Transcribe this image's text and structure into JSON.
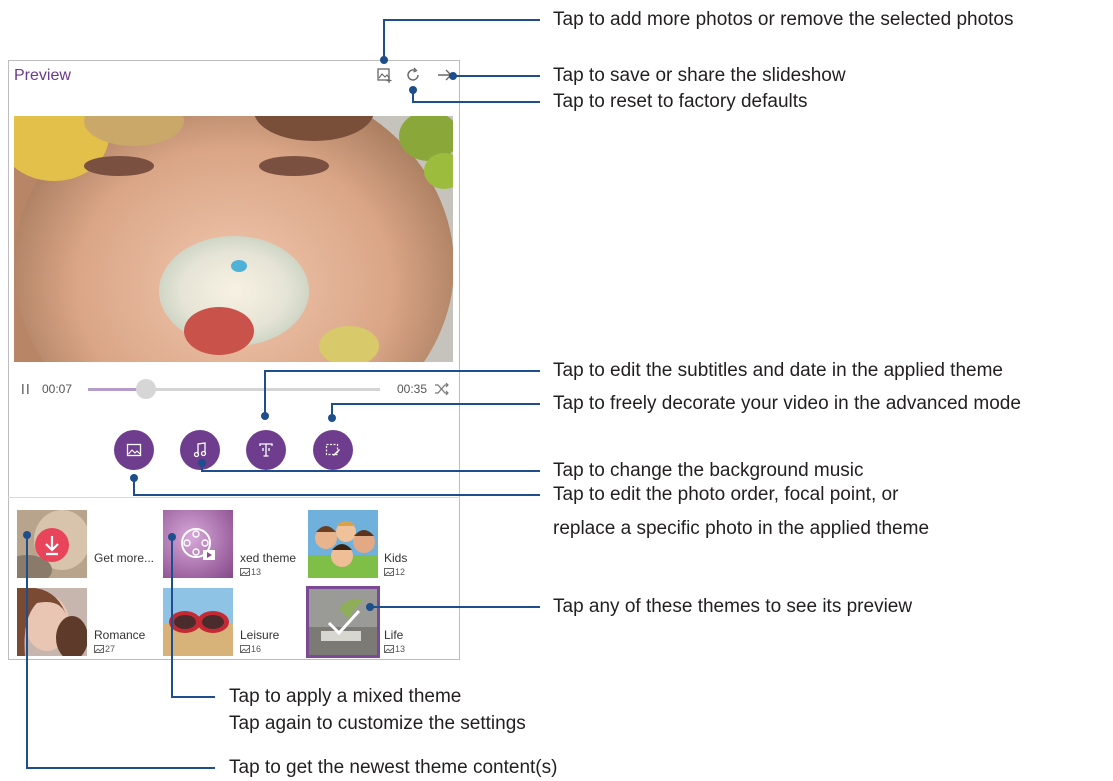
{
  "app": {
    "title": "Preview"
  },
  "player": {
    "current_time": "00:07",
    "total_time": "00:35",
    "progress": 0.2
  },
  "themes": [
    {
      "name": "Get more...",
      "count": "",
      "kind": "download"
    },
    {
      "name": "xed theme",
      "count": "13",
      "kind": "mixed"
    },
    {
      "name": "Kids",
      "count": "12",
      "kind": "kids"
    },
    {
      "name": "Romance",
      "count": "27",
      "kind": "romance"
    },
    {
      "name": "Leisure",
      "count": "16",
      "kind": "leisure"
    },
    {
      "name": "Life",
      "count": "13",
      "kind": "life",
      "selected": true
    }
  ],
  "callouts": {
    "add_photos": "Tap to add more photos or remove the selected photos",
    "save_share": "Tap to save or share the slideshow",
    "reset": "Tap to reset to factory defaults",
    "subtitles": "Tap to edit the subtitles and date in the applied theme",
    "decorate": "Tap to freely decorate your video in the advanced mode",
    "music": "Tap to change the background music",
    "photo_order_1": "Tap to edit the photo order, focal point, or",
    "photo_order_2": "replace a specific photo in the applied theme",
    "themes_preview": "Tap any of these themes to see its preview",
    "mixed_1": "Tap to apply a mixed theme",
    "mixed_2": "Tap again to customize the settings",
    "newest": "Tap to get the newest theme content(s)"
  },
  "colors": {
    "accent": "#6f3d8e",
    "callout_line": "#1f4e8c",
    "download_badge": "#e8445a"
  }
}
